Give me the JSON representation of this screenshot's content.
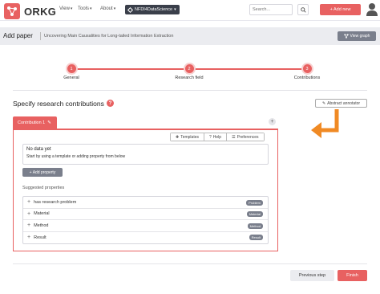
{
  "nav": {
    "logo_text": "ORKG",
    "links": [
      {
        "label": "View"
      },
      {
        "label": "Tools"
      },
      {
        "label": "About"
      }
    ],
    "kg_badge": "NFDI4DataScience",
    "search_placeholder": "Search...",
    "add_new_label": "+ Add new"
  },
  "header": {
    "title": "Add paper",
    "subtitle": "Uncovering Main Causalities for Long-tailed Information Extraction",
    "view_graph_label": "View graph"
  },
  "stepper": {
    "steps": [
      {
        "number": "1",
        "label": "General"
      },
      {
        "number": "2",
        "label": "Research field"
      },
      {
        "number": "3",
        "label": "Contributions"
      }
    ]
  },
  "contributions": {
    "title": "Specify research contributions",
    "help_symbol": "?",
    "abstract_annotator_label": "Abstract annotator",
    "tab_label": "Contribution 1",
    "add_contribution_symbol": "+",
    "toolbar": {
      "templates_label": "Templates",
      "help_label": "Help",
      "preferences_label": "Preferences"
    },
    "no_data_title": "No data yet",
    "no_data_text": "Start by using a template or adding property from below",
    "add_property_label": "+ Add property",
    "suggested_label": "Suggested properties",
    "suggested": [
      {
        "label": "has research problem",
        "badge": "Problem"
      },
      {
        "label": "Material",
        "badge": "Material"
      },
      {
        "label": "Method",
        "badge": "Method"
      },
      {
        "label": "Result",
        "badge": "Result"
      }
    ]
  },
  "footer": {
    "previous_label": "Previous step",
    "finish_label": "Finish"
  },
  "colors": {
    "accent": "#e86161",
    "secondary": "#7a7f8c",
    "arrow": "#f08a24"
  }
}
